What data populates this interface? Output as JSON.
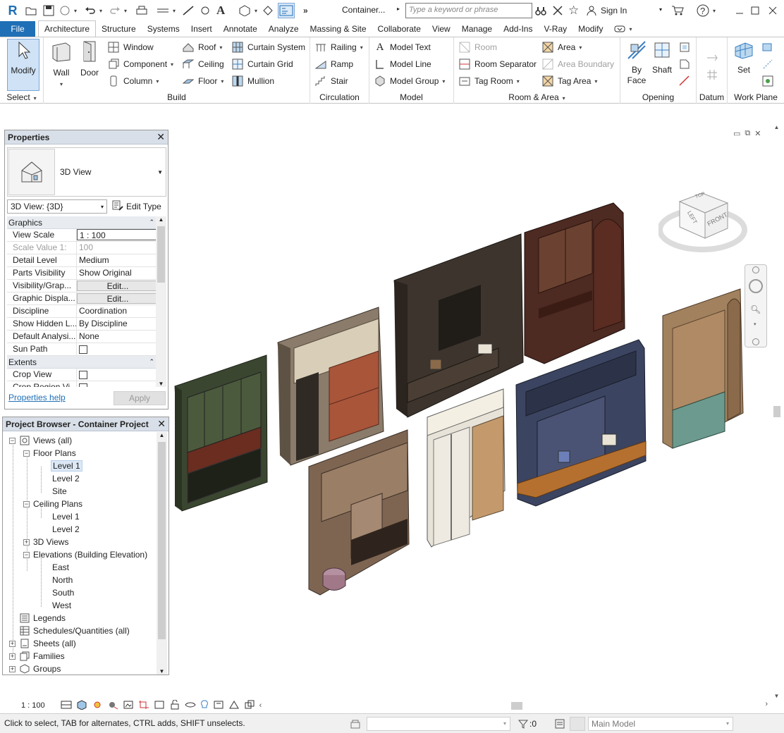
{
  "titlebar": {
    "app_logo": "R",
    "document_title": "Container...",
    "search_placeholder": "Type a keyword or phrase",
    "sign_in": "Sign In"
  },
  "tabs": [
    "File",
    "Architecture",
    "Structure",
    "Systems",
    "Insert",
    "Annotate",
    "Analyze",
    "Massing & Site",
    "Collaborate",
    "View",
    "Manage",
    "Add-Ins",
    "V-Ray",
    "Modify"
  ],
  "active_tab": "Architecture",
  "ribbon": {
    "select": {
      "button": "Modify",
      "group": "Select"
    },
    "build": {
      "group": "Build",
      "wall": "Wall",
      "door": "Door",
      "window": "Window",
      "component": "Component",
      "column": "Column",
      "roof": "Roof",
      "ceiling": "Ceiling",
      "floor": "Floor",
      "curtain_system": "Curtain  System",
      "curtain_grid": "Curtain  Grid",
      "mullion": "Mullion"
    },
    "circulation": {
      "group": "Circulation",
      "railing": "Railing",
      "ramp": "Ramp",
      "stair": "Stair"
    },
    "model": {
      "group": "Model",
      "model_text": "Model  Text",
      "model_line": "Model  Line",
      "model_group": "Model  Group"
    },
    "room_area": {
      "group": "Room & Area",
      "room": "Room",
      "room_separator": "Room  Separator",
      "tag_room": "Tag  Room",
      "area": "Area",
      "area_boundary": "Area  Boundary",
      "tag_area": "Tag  Area"
    },
    "opening": {
      "group": "Opening",
      "by_face": "By Face",
      "shaft": "Shaft"
    },
    "datum": {
      "group": "Datum"
    },
    "work_plane": {
      "group": "Work Plane",
      "set": "Set"
    }
  },
  "properties": {
    "title": "Properties",
    "type_name": "3D View",
    "instance_selector": "3D View: {3D}",
    "edit_type": "Edit Type",
    "sections": [
      {
        "name": "Graphics",
        "rows": [
          {
            "name": "View Scale",
            "value": "1 : 100"
          },
          {
            "name": "Scale Value    1:",
            "value": "100"
          },
          {
            "name": "Detail Level",
            "value": "Medium"
          },
          {
            "name": "Parts Visibility",
            "value": "Show Original"
          },
          {
            "name": "Visibility/Grap...",
            "value": "Edit..."
          },
          {
            "name": "Graphic Displa...",
            "value": "Edit..."
          },
          {
            "name": "Discipline",
            "value": "Coordination"
          },
          {
            "name": "Show Hidden L...",
            "value": "By Discipline"
          },
          {
            "name": "Default Analysi...",
            "value": "None"
          },
          {
            "name": "Sun Path",
            "value": ""
          }
        ]
      },
      {
        "name": "Extents",
        "rows": [
          {
            "name": "Crop View",
            "value": ""
          },
          {
            "name": "Crop Region Vi...",
            "value": ""
          }
        ]
      }
    ],
    "help_link": "Properties help",
    "apply": "Apply"
  },
  "browser": {
    "title": "Project Browser - Container Project",
    "nodes": [
      {
        "label": "Views (all)"
      },
      {
        "label": "Floor Plans"
      },
      {
        "label": "Level 1"
      },
      {
        "label": "Level 2"
      },
      {
        "label": "Site"
      },
      {
        "label": "Ceiling Plans"
      },
      {
        "label": "Level 1"
      },
      {
        "label": "Level 2"
      },
      {
        "label": "3D Views"
      },
      {
        "label": "Elevations (Building Elevation)"
      },
      {
        "label": "East"
      },
      {
        "label": "North"
      },
      {
        "label": "South"
      },
      {
        "label": "West"
      },
      {
        "label": "Legends"
      },
      {
        "label": "Schedules/Quantities (all)"
      },
      {
        "label": "Sheets (all)"
      },
      {
        "label": "Families"
      },
      {
        "label": "Groups"
      }
    ]
  },
  "viewcube": {
    "top": "TOP",
    "left": "LEFT",
    "front": "FRONT"
  },
  "view_control": {
    "scale": "1 : 100"
  },
  "status": {
    "message": "Click to select, TAB for alternates, CTRL adds, SHIFT unselects.",
    "select_count": ":0",
    "workset": "Main Model"
  }
}
